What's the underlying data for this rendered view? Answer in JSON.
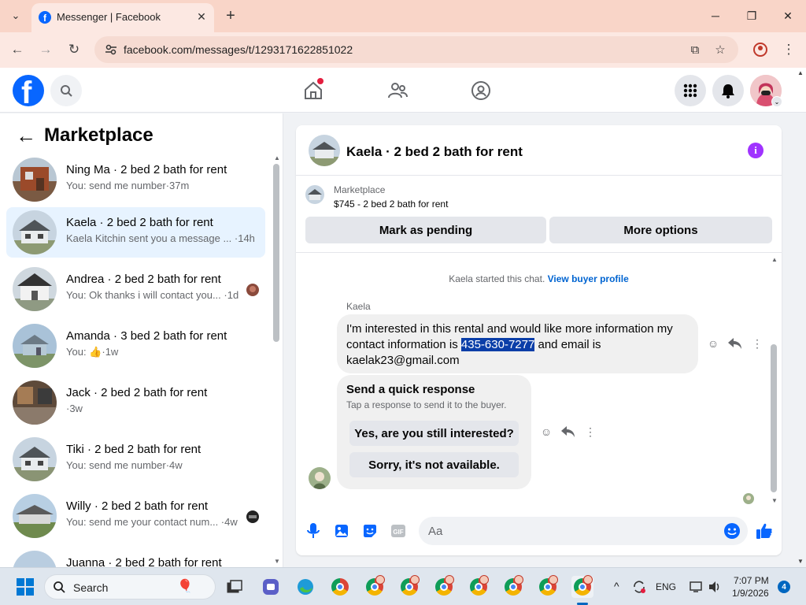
{
  "browser": {
    "tab_title": "Messenger | Facebook",
    "url": "facebook.com/messages/t/1293171622851022"
  },
  "left_panel": {
    "title": "Marketplace",
    "conversations": [
      {
        "name": "Ning Ma · 2 bed 2 bath for rent",
        "preview": "You: send me number·37m"
      },
      {
        "name": "Kaela · 2 bed 2 bath for rent",
        "preview": "Kaela Kitchin sent you a message ... ·14h"
      },
      {
        "name": "Andrea · 2 bed 2 bath for rent",
        "preview": "You: Ok thanks i will contact you... ·1d"
      },
      {
        "name": "Amanda · 3 bed 2 bath for rent",
        "preview_prefix": "You: ",
        "preview_suffix": "·1w"
      },
      {
        "name": "Jack · 2 bed 2 bath for rent",
        "preview": "·3w"
      },
      {
        "name": "Tiki · 2 bed 2 bath for rent",
        "preview": "You: send me number·4w"
      },
      {
        "name": "Willy · 2 bed 2 bath for rent",
        "preview": "You: send me your contact num... ·4w"
      },
      {
        "name": "Juanna · 2 bed 2 bath for rent",
        "preview": ""
      }
    ]
  },
  "chat": {
    "title": "Kaela · 2 bed 2 bath for rent",
    "marketplace_label": "Marketplace",
    "listing": "$745 - 2 bed 2 bath for rent",
    "mark_pending": "Mark as pending",
    "more_options": "More options",
    "started_text": "Kaela started this chat.",
    "view_profile": "View buyer profile",
    "sender": "Kaela",
    "message_before": "I'm interested in this rental and would like more information my contact information is ",
    "message_phone": "435-630-7277",
    "message_after": " and email is kaelak23@gmail.com",
    "quick_title": "Send a quick response",
    "quick_sub": "Tap a response to send it to the buyer.",
    "quick_options": [
      "Yes, are you still interested?",
      "Sorry, it's not available."
    ],
    "composer_placeholder": "Aa"
  },
  "taskbar": {
    "search_label": "Search",
    "lang": "ENG",
    "time": "7:07 PM",
    "date": "1/9/2026",
    "notifications": "4"
  },
  "colors": {
    "fb_blue": "#0866ff",
    "accent_purple": "#a033ff",
    "highlight": "#0a3ea8"
  }
}
